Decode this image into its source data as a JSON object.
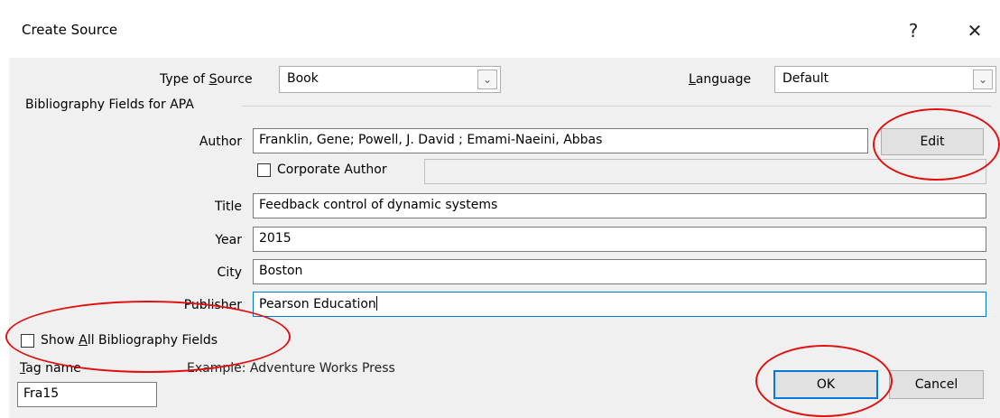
{
  "window": {
    "title": "Create Source",
    "help_glyph": "?",
    "close_glyph": "✕"
  },
  "source": {
    "type_label_pre": "Type of ",
    "type_label_key": "S",
    "type_label_post": "ource",
    "type_value": "Book",
    "language_label_key": "L",
    "language_label_post": "anguage",
    "language_value": "Default"
  },
  "group": {
    "title": "Bibliography Fields for APA"
  },
  "fields": {
    "author_label": "Author",
    "author_value": "Franklin, Gene; Powell, J. David ; Emami-Naeini, Abbas",
    "edit_label": "Edit",
    "corporate_label": "Corporate Author",
    "corporate_value": "",
    "title_label": "Title",
    "title_value": "Feedback control of dynamic systems",
    "year_label": "Year",
    "year_value": "2015",
    "city_label": "City",
    "city_value": "Boston",
    "publisher_label": "Publisher",
    "publisher_value": "Pearson Education"
  },
  "footer": {
    "show_all_pre": "Show ",
    "show_all_key": "A",
    "show_all_post": "ll Bibliography Fields",
    "tag_label_key": "T",
    "tag_label_post": "ag name",
    "example_text": "Example: Adventure Works Press",
    "tag_value": "Fra15",
    "ok_label": "OK",
    "cancel_label": "Cancel"
  },
  "colors": {
    "annotation": "#e01010",
    "default_button_border": "#0078d7",
    "dialog_bg": "#f0f0f0"
  },
  "icons": {
    "dropdown": "chevron-down-icon",
    "help": "help-icon",
    "close": "close-icon"
  }
}
